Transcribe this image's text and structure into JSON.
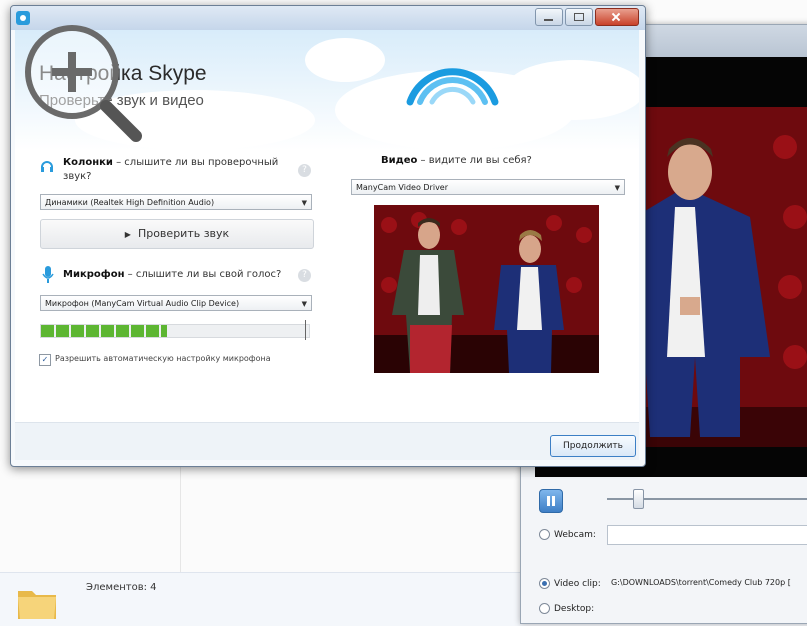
{
  "explorer": {
    "items_count": "Элементов: 4"
  },
  "player": {
    "sources": [
      {
        "label": "Webcam:",
        "selected": false
      },
      {
        "label": "Video clip:",
        "selected": true
      },
      {
        "label": "Desktop:",
        "selected": false
      }
    ],
    "clip_path": "G:\\DOWNLOADS\\torrent\\Comedy Club 720p [",
    "seek_position": 0.12
  },
  "dialog": {
    "window_title": "Настройка Skype",
    "title": "Настройка Skype",
    "subtitle": "Проверьте звук и видео",
    "speakers": {
      "label": "Колонки",
      "question": " – слышите ли вы проверочный звук?",
      "device": "Динамики (Realtek High Definition Audio)",
      "test_button": "Проверить звук"
    },
    "microphone": {
      "label": "Микрофон",
      "question": " – слышите ли вы свой голос?",
      "device": "Микрофон (ManyCam Virtual Audio Clip Device)",
      "level": 0.47
    },
    "video": {
      "label": "Видео",
      "question": " – видите ли вы себя?",
      "device": "ManyCam Video Driver"
    },
    "auto_mic_checkbox": {
      "label": "Разрешить автоматическую настройку микрофона",
      "checked": true
    },
    "continue_button": "Продолжить"
  },
  "colors": {
    "skype_blue": "#2a9bdc",
    "meter_green": "#5db632",
    "stage_red": "#7a0a10"
  }
}
